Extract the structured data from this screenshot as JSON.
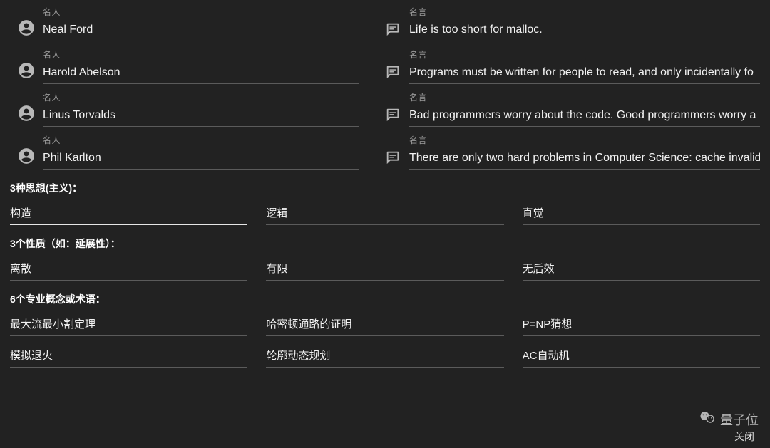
{
  "labels": {
    "person": "名人",
    "quote": "名言",
    "close": "关闭"
  },
  "watermark": {
    "text": "量子位"
  },
  "people": [
    {
      "name": "Neal Ford",
      "quote": "Life is too short for malloc."
    },
    {
      "name": "Harold Abelson",
      "quote": "Programs must be written for people to read, and only incidentally fo"
    },
    {
      "name": "Linus Torvalds",
      "quote": "Bad programmers worry about the code. Good programmers worry a"
    },
    {
      "name": "Phil Karlton",
      "quote": "There are only two hard problems in Computer Science: cache invalid"
    }
  ],
  "sections": {
    "thoughts": {
      "heading": "3种思想(主义)：",
      "items": [
        "构造",
        "逻辑",
        "直觉"
      ]
    },
    "properties": {
      "heading": "3个性质（如：延展性）：",
      "items": [
        "离散",
        "有限",
        "无后效"
      ]
    },
    "terms": {
      "heading": "6个专业概念或术语：",
      "items": [
        "最大流最小割定理",
        "哈密顿通路的证明",
        "P=NP猜想",
        "模拟退火",
        "轮廓动态规划",
        "AC自动机"
      ]
    }
  }
}
